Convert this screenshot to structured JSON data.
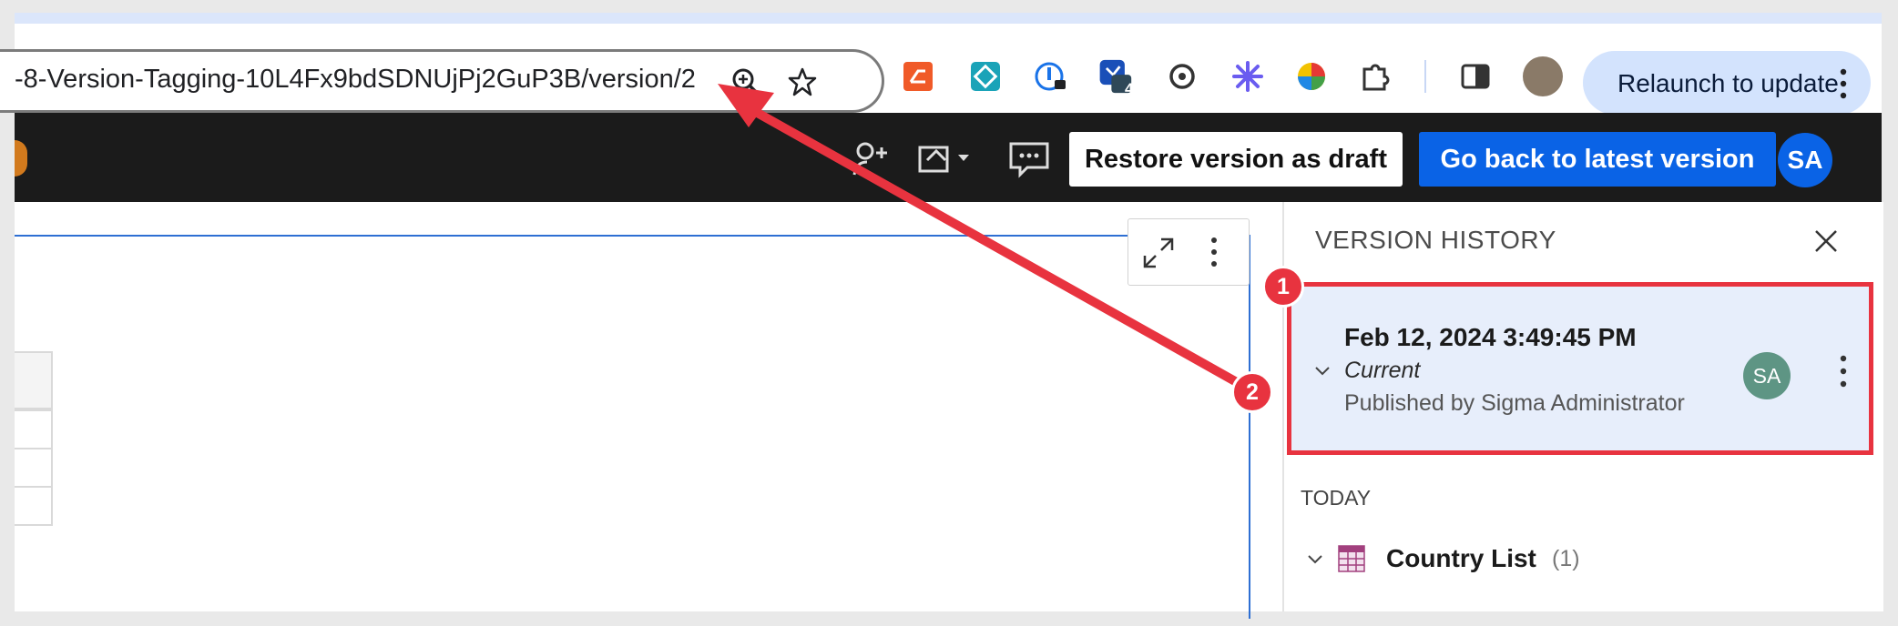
{
  "browser": {
    "url": "-8-Version-Tagging-10L4Fx9bdSDNUjPj2GuP3B/version/2",
    "extension_badge": "4",
    "relaunch_label": "Relaunch to update"
  },
  "appbar": {
    "restore_label": "Restore version as draft",
    "latest_label": "Go back to latest version",
    "avatar_initials": "SA"
  },
  "version_panel": {
    "title": "VERSION HISTORY",
    "current_version": {
      "date": "Feb 12, 2024 3:49:45 PM",
      "status": "Current",
      "published_by": "Published by Sigma Administrator",
      "avatar_initials": "SA"
    },
    "section_label": "TODAY",
    "items": [
      {
        "name": "Country List",
        "count": "(1)"
      }
    ]
  },
  "callouts": [
    "1",
    "2"
  ],
  "colors": {
    "accent": "#0a63e6",
    "callout": "#e8333f",
    "card_bg": "#e7eefb"
  }
}
